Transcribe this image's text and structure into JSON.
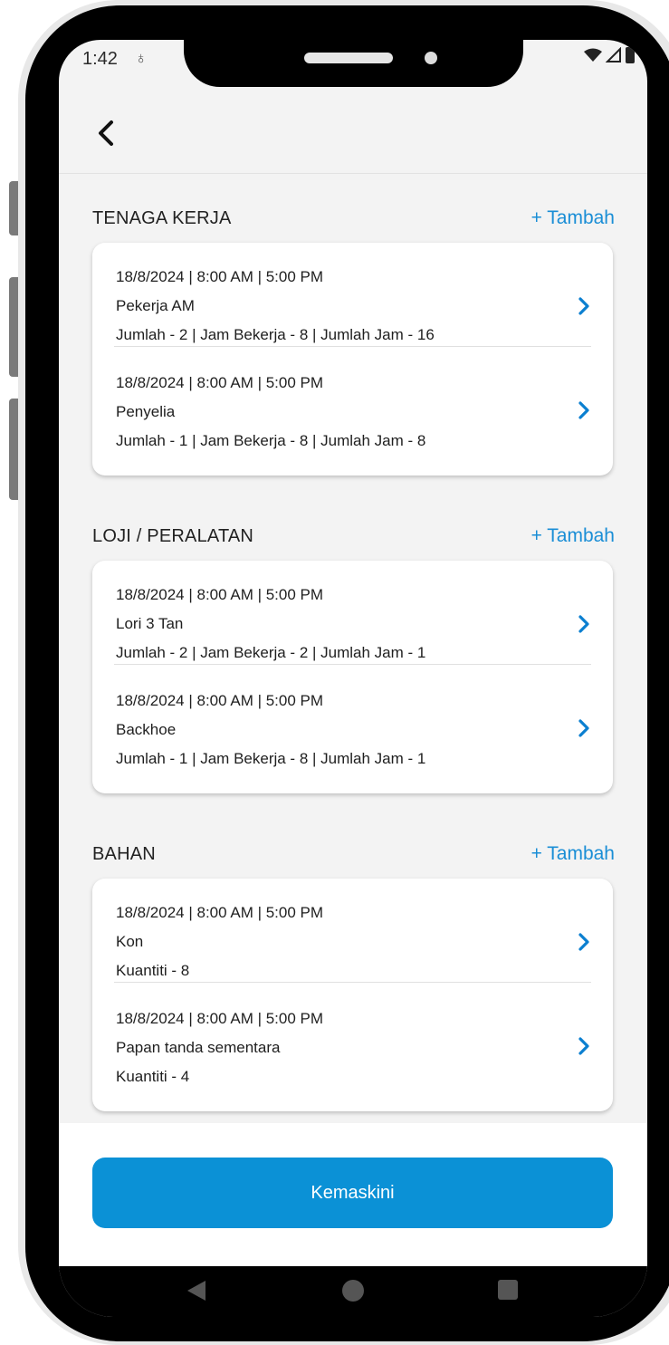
{
  "status": {
    "time": "1:42",
    "glyph": "♁"
  },
  "header": {
    "back_icon": "chevron-left-icon"
  },
  "sections": [
    {
      "title": "TENAGA KERJA",
      "add_label": "+ Tambah",
      "items": [
        {
          "datetime": "18/8/2024 | 8:00 AM | 5:00 PM",
          "name": "Pekerja AM",
          "detail": "Jumlah - 2 | Jam Bekerja - 8 | Jumlah Jam - 16"
        },
        {
          "datetime": "18/8/2024 | 8:00 AM | 5:00 PM",
          "name": "Penyelia",
          "detail": "Jumlah - 1 | Jam Bekerja - 8 | Jumlah Jam - 8"
        }
      ]
    },
    {
      "title": "LOJI / PERALATAN",
      "add_label": "+ Tambah",
      "items": [
        {
          "datetime": "18/8/2024 | 8:00 AM | 5:00 PM",
          "name": "Lori 3 Tan",
          "detail": "Jumlah - 2 | Jam Bekerja - 2 | Jumlah Jam - 1"
        },
        {
          "datetime": "18/8/2024 | 8:00 AM | 5:00 PM",
          "name": "Backhoe",
          "detail": "Jumlah - 1 | Jam Bekerja - 8 | Jumlah Jam - 1"
        }
      ]
    },
    {
      "title": "BAHAN",
      "add_label": "+ Tambah",
      "items": [
        {
          "datetime": "18/8/2024 | 8:00 AM | 5:00 PM",
          "name": "Kon",
          "detail": "Kuantiti - 8"
        },
        {
          "datetime": "18/8/2024 | 8:00 AM | 5:00 PM",
          "name": "Papan tanda sementara",
          "detail": "Kuantiti - 4"
        }
      ]
    }
  ],
  "footer": {
    "update_label": "Kemaskini"
  },
  "colors": {
    "accent": "#1a8ed6",
    "button": "#0b91d6",
    "background": "#f3f3f3"
  }
}
